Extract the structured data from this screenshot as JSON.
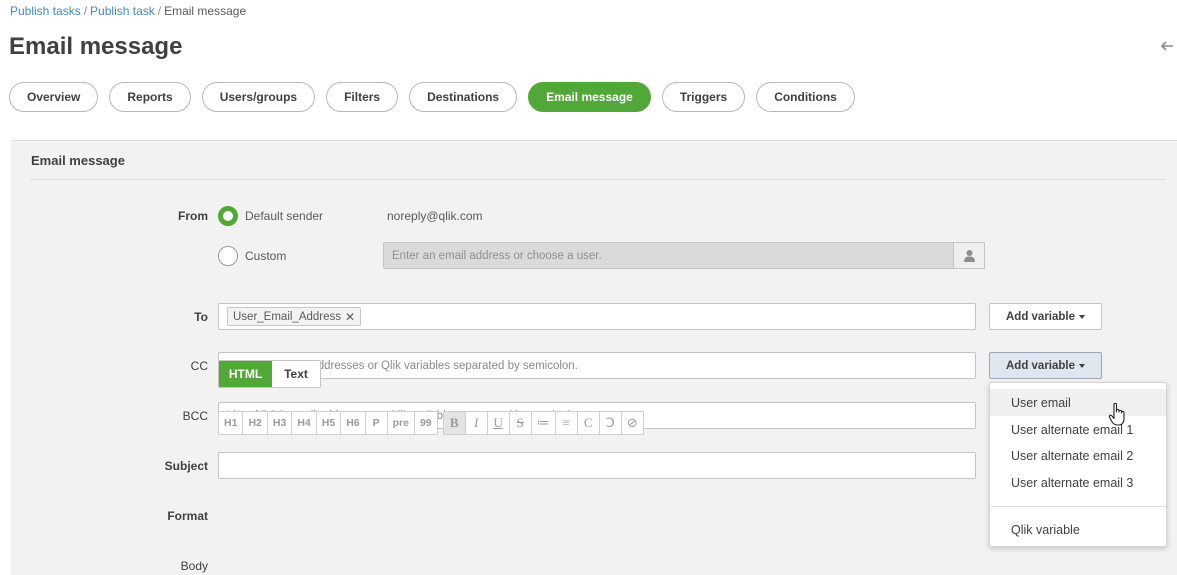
{
  "breadcrumb": {
    "item1": "Publish tasks",
    "item2": "Publish task",
    "current": "Email message",
    "separator": "/"
  },
  "page": {
    "title": "Email message"
  },
  "tabs": [
    {
      "label": "Overview"
    },
    {
      "label": "Reports"
    },
    {
      "label": "Users/groups"
    },
    {
      "label": "Filters"
    },
    {
      "label": "Destinations"
    },
    {
      "label": "Email message",
      "active": true
    },
    {
      "label": "Triggers"
    },
    {
      "label": "Conditions"
    }
  ],
  "panel": {
    "title": "Email message"
  },
  "from": {
    "label": "From",
    "default_label": "Default sender",
    "default_email": "noreply@qlik.com",
    "custom_label": "Custom",
    "custom_placeholder": "Enter an email address or choose a user."
  },
  "to": {
    "label": "To",
    "chip": "User_Email_Address",
    "chip_remove": "✕",
    "add_variable": "Add variable"
  },
  "cc": {
    "label": "CC",
    "placeholder": "List of CC email addresses or Qlik variables separated by semicolon.",
    "add_variable": "Add variable"
  },
  "bcc": {
    "label": "BCC",
    "placeholder": "List of BCC email addresses or Qlik variables separated by semicolon."
  },
  "subject": {
    "label": "Subject",
    "value": ""
  },
  "format": {
    "label": "Format",
    "html": "HTML",
    "text": "Text",
    "selected": "HTML"
  },
  "body": {
    "label": "Body",
    "toolbar": [
      "H1",
      "H2",
      "H3",
      "H4",
      "H5",
      "H6",
      "P",
      "pre",
      "99",
      "B",
      "I",
      "U",
      "S",
      "≔",
      "≡",
      "C",
      "Ↄ",
      "⊘"
    ]
  },
  "dropdown": {
    "items": [
      "User email",
      "User alternate email 1",
      "User alternate email 2",
      "User alternate email 3"
    ],
    "extra_item": "Qlik variable",
    "hovered": "User email"
  },
  "colors": {
    "accent": "#52a739",
    "link": "#3f8bb8",
    "panel_bg": "#f2f2f2"
  },
  "icons": {
    "back": "back-arrow-icon",
    "user_picker": "user-icon",
    "cursor": "hand-pointer-icon"
  }
}
